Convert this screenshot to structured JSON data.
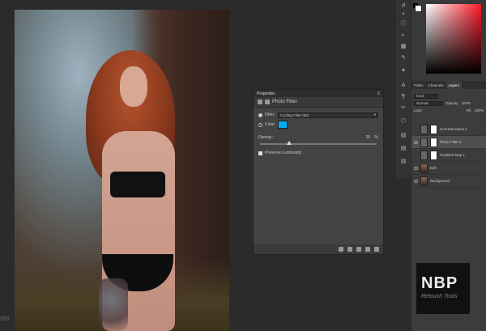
{
  "canvas": {
    "tools_text": "ols"
  },
  "properties": {
    "title": "Properties",
    "panel_type": "Photo Filter",
    "filter_label": "Filter:",
    "filter_value": "Cooling Filter (82)",
    "color_label": "Color:",
    "color_value": "#00a8f0",
    "density_label": "Density:",
    "density_value": "25",
    "density_unit": "%",
    "density_fraction": 0.25,
    "preserve_label": "Preserve Luminosity"
  },
  "layers_panel": {
    "tabs": [
      "Paths",
      "Channels",
      "Layers"
    ],
    "kind_label": "Kind",
    "blend_mode": "Normal",
    "opacity_label": "Opacity:",
    "opacity_value": "100%",
    "lock_label": "Lock:",
    "fill_label": "Fill:",
    "fill_value": "100%",
    "layers": [
      {
        "name": "Hue/Saturation 1"
      },
      {
        "name": "Photo Filter 1"
      },
      {
        "name": "Gradient Map 1"
      },
      {
        "name": "Edit"
      },
      {
        "name": "Background"
      }
    ]
  },
  "logo": {
    "main": "NBP",
    "sub": "Retouch Tools"
  }
}
